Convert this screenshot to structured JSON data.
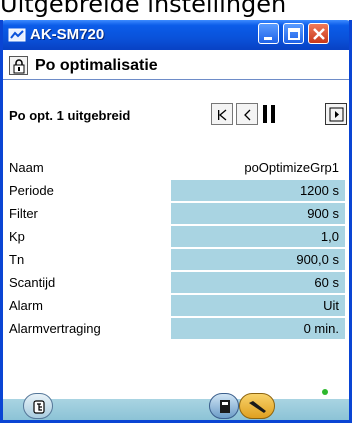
{
  "page_caption": "Uitgebreide instellingen",
  "window": {
    "title": "AK-SM720"
  },
  "header": {
    "title": "Po optimalisatie"
  },
  "subheader": {
    "title": "Po opt. 1 uitgebreid"
  },
  "settings": [
    {
      "label": "Naam",
      "value": "poOptimizeGrp1",
      "editable": false
    },
    {
      "label": "Periode",
      "value": "1200 s",
      "editable": true
    },
    {
      "label": "Filter",
      "value": "900 s",
      "editable": true
    },
    {
      "label": "Kp",
      "value": "1,0",
      "editable": true
    },
    {
      "label": "Tn",
      "value": "900,0 s",
      "editable": true
    },
    {
      "label": "Scantijd",
      "value": "60 s",
      "editable": true
    },
    {
      "label": "Alarm",
      "value": "Uit",
      "editable": true
    },
    {
      "label": "Alarmvertraging",
      "value": "0 min.",
      "editable": true
    }
  ],
  "colors": {
    "titlebar": "#0A52DA",
    "value_field": "#A9D4E2",
    "status_ok": "#2DB82D"
  }
}
